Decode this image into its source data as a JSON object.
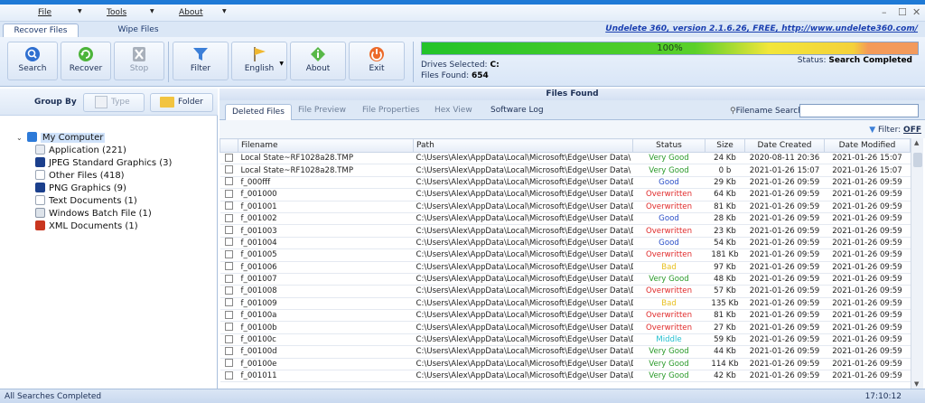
{
  "menu": {
    "file": "File",
    "tools": "Tools",
    "about": "About"
  },
  "ribbon_tabs": [
    "Recover Files",
    "Wipe Files"
  ],
  "version_link": "Undelete 360, version 2.1.6.26, FREE, http://www.undelete360.com/",
  "toolbar": {
    "search": "Search",
    "recover": "Recover",
    "stop": "Stop",
    "filter": "Filter",
    "english": "English",
    "about": "About",
    "exit": "Exit"
  },
  "progress": {
    "percent_label": "100%",
    "value": 1.0
  },
  "drives_label": "Drives Selected:",
  "drives_value": "C:",
  "files_found_label": "Files Found:",
  "files_found_value": "654",
  "status_label": "Status:",
  "status_value": "Search Completed",
  "group_by": {
    "label": "Group By",
    "type": "Type",
    "folder": "Folder"
  },
  "tree": {
    "root": "My Computer",
    "items": [
      "Application (221)",
      "JPEG Standard Graphics (3)",
      "Other Files (418)",
      "PNG Graphics (9)",
      "Text Documents (1)",
      "Windows Batch File (1)",
      "XML Documents (1)"
    ]
  },
  "files_found_title": "Files Found",
  "subtabs": [
    "Deleted Files",
    "File Preview",
    "File Properties",
    "Hex View",
    "Software Log"
  ],
  "filename_search_label": "Filename Search:",
  "filter_label": "Filter:",
  "filter_value": "OFF",
  "columns": [
    "Filename",
    "Path",
    "Status",
    "Size",
    "Date Created",
    "Date Modified"
  ],
  "rows": [
    {
      "name": "Local State~RF1028a28.TMP",
      "path": "C:\\Users\\Alex\\AppData\\Local\\Microsoft\\Edge\\User Data\\",
      "status": "Very Good",
      "size": "24 Kb",
      "created": "2020-08-11 20:36",
      "modified": "2021-01-26 15:07"
    },
    {
      "name": "Local State~RF1028a28.TMP",
      "path": "C:\\Users\\Alex\\AppData\\Local\\Microsoft\\Edge\\User Data\\",
      "status": "Very Good",
      "size": "0 b",
      "created": "2021-01-26 15:07",
      "modified": "2021-01-26 15:07"
    },
    {
      "name": "f_000fff",
      "path": "C:\\Users\\Alex\\AppData\\Local\\Microsoft\\Edge\\User Data\\Def...",
      "status": "Good",
      "size": "29 Kb",
      "created": "2021-01-26 09:59",
      "modified": "2021-01-26 09:59"
    },
    {
      "name": "f_001000",
      "path": "C:\\Users\\Alex\\AppData\\Local\\Microsoft\\Edge\\User Data\\Def...",
      "status": "Overwritten",
      "size": "64 Kb",
      "created": "2021-01-26 09:59",
      "modified": "2021-01-26 09:59"
    },
    {
      "name": "f_001001",
      "path": "C:\\Users\\Alex\\AppData\\Local\\Microsoft\\Edge\\User Data\\Def...",
      "status": "Overwritten",
      "size": "81 Kb",
      "created": "2021-01-26 09:59",
      "modified": "2021-01-26 09:59"
    },
    {
      "name": "f_001002",
      "path": "C:\\Users\\Alex\\AppData\\Local\\Microsoft\\Edge\\User Data\\Def...",
      "status": "Good",
      "size": "28 Kb",
      "created": "2021-01-26 09:59",
      "modified": "2021-01-26 09:59"
    },
    {
      "name": "f_001003",
      "path": "C:\\Users\\Alex\\AppData\\Local\\Microsoft\\Edge\\User Data\\Def...",
      "status": "Overwritten",
      "size": "23 Kb",
      "created": "2021-01-26 09:59",
      "modified": "2021-01-26 09:59"
    },
    {
      "name": "f_001004",
      "path": "C:\\Users\\Alex\\AppData\\Local\\Microsoft\\Edge\\User Data\\Def...",
      "status": "Good",
      "size": "54 Kb",
      "created": "2021-01-26 09:59",
      "modified": "2021-01-26 09:59"
    },
    {
      "name": "f_001005",
      "path": "C:\\Users\\Alex\\AppData\\Local\\Microsoft\\Edge\\User Data\\Def...",
      "status": "Overwritten",
      "size": "181 Kb",
      "created": "2021-01-26 09:59",
      "modified": "2021-01-26 09:59"
    },
    {
      "name": "f_001006",
      "path": "C:\\Users\\Alex\\AppData\\Local\\Microsoft\\Edge\\User Data\\Def...",
      "status": "Bad",
      "size": "97 Kb",
      "created": "2021-01-26 09:59",
      "modified": "2021-01-26 09:59"
    },
    {
      "name": "f_001007",
      "path": "C:\\Users\\Alex\\AppData\\Local\\Microsoft\\Edge\\User Data\\Def...",
      "status": "Very Good",
      "size": "48 Kb",
      "created": "2021-01-26 09:59",
      "modified": "2021-01-26 09:59"
    },
    {
      "name": "f_001008",
      "path": "C:\\Users\\Alex\\AppData\\Local\\Microsoft\\Edge\\User Data\\Def...",
      "status": "Overwritten",
      "size": "57 Kb",
      "created": "2021-01-26 09:59",
      "modified": "2021-01-26 09:59"
    },
    {
      "name": "f_001009",
      "path": "C:\\Users\\Alex\\AppData\\Local\\Microsoft\\Edge\\User Data\\Def...",
      "status": "Bad",
      "size": "135 Kb",
      "created": "2021-01-26 09:59",
      "modified": "2021-01-26 09:59"
    },
    {
      "name": "f_00100a",
      "path": "C:\\Users\\Alex\\AppData\\Local\\Microsoft\\Edge\\User Data\\Def...",
      "status": "Overwritten",
      "size": "81 Kb",
      "created": "2021-01-26 09:59",
      "modified": "2021-01-26 09:59"
    },
    {
      "name": "f_00100b",
      "path": "C:\\Users\\Alex\\AppData\\Local\\Microsoft\\Edge\\User Data\\Def...",
      "status": "Overwritten",
      "size": "27 Kb",
      "created": "2021-01-26 09:59",
      "modified": "2021-01-26 09:59"
    },
    {
      "name": "f_00100c",
      "path": "C:\\Users\\Alex\\AppData\\Local\\Microsoft\\Edge\\User Data\\Def...",
      "status": "Middle",
      "size": "59 Kb",
      "created": "2021-01-26 09:59",
      "modified": "2021-01-26 09:59"
    },
    {
      "name": "f_00100d",
      "path": "C:\\Users\\Alex\\AppData\\Local\\Microsoft\\Edge\\User Data\\Def...",
      "status": "Very Good",
      "size": "44 Kb",
      "created": "2021-01-26 09:59",
      "modified": "2021-01-26 09:59"
    },
    {
      "name": "f_00100e",
      "path": "C:\\Users\\Alex\\AppData\\Local\\Microsoft\\Edge\\User Data\\Def...",
      "status": "Very Good",
      "size": "114 Kb",
      "created": "2021-01-26 09:59",
      "modified": "2021-01-26 09:59"
    },
    {
      "name": "f_001011",
      "path": "C:\\Users\\Alex\\AppData\\Local\\Microsoft\\Edge\\User Data\\Def...",
      "status": "Very Good",
      "size": "42 Kb",
      "created": "2021-01-26 09:59",
      "modified": "2021-01-26 09:59"
    }
  ],
  "status_colors": {
    "Very Good": "#2a9a2a",
    "Good": "#2a4fc8",
    "Overwritten": "#e02a2a",
    "Bad": "#e8c020",
    "Middle": "#22bfcf"
  },
  "statusbar": {
    "left": "All Searches Completed",
    "time": "17:10:12"
  }
}
